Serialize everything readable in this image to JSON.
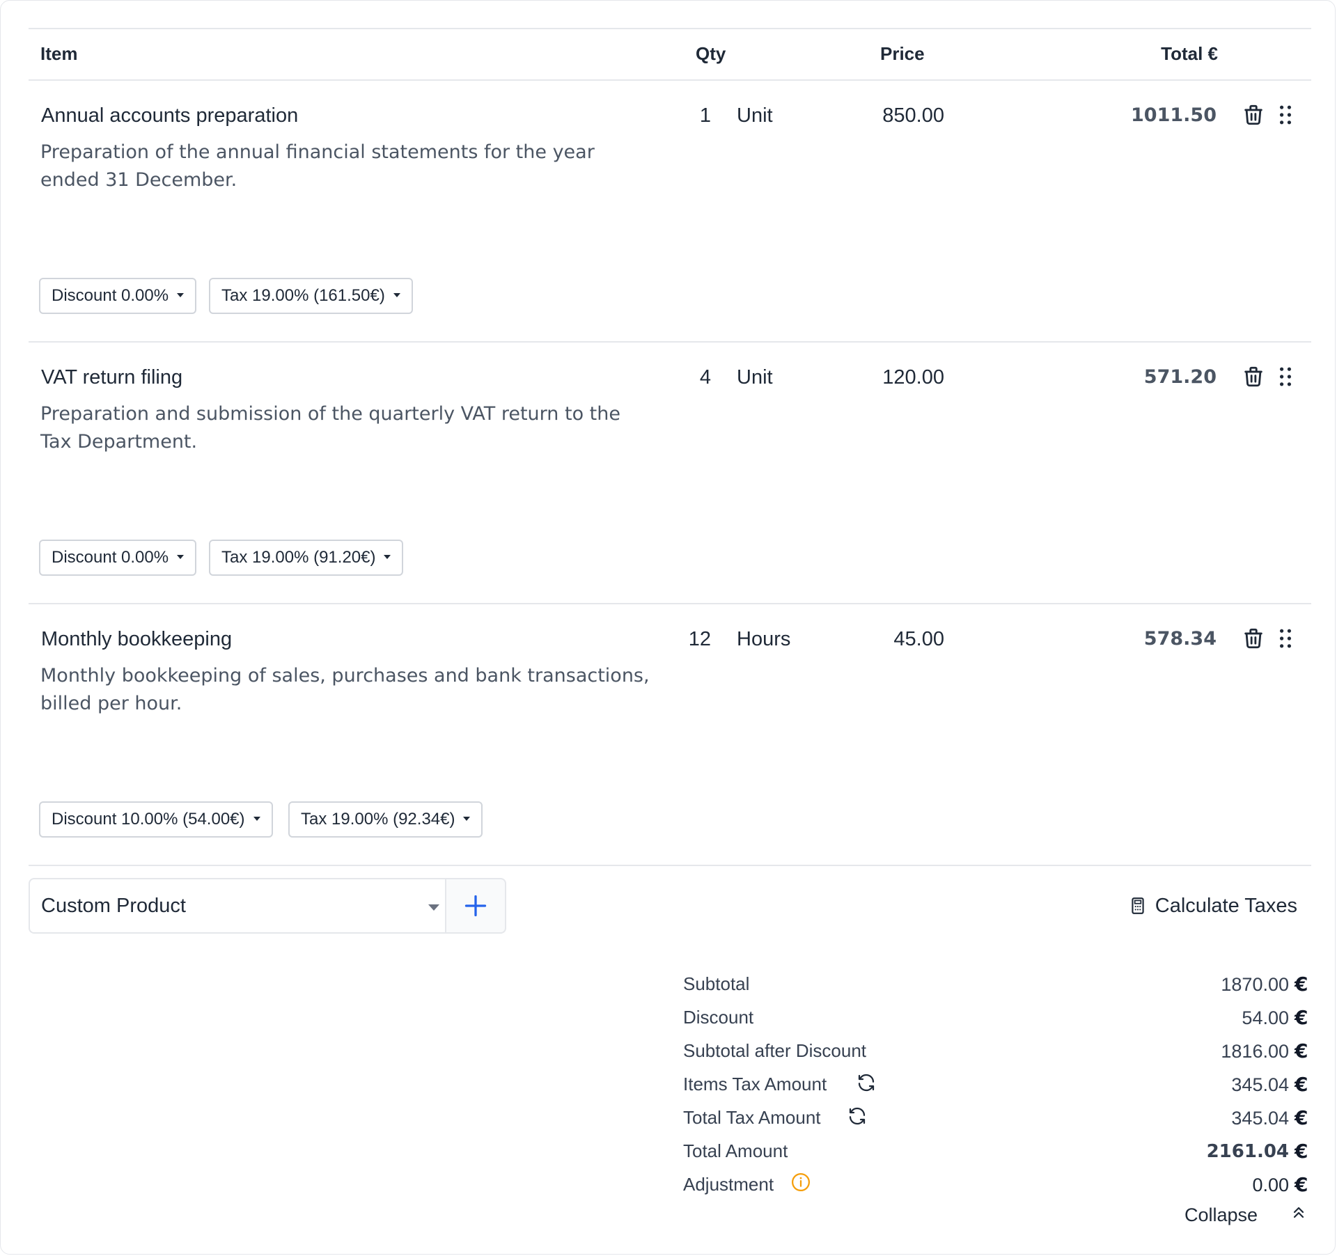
{
  "table_header": {
    "item": "Item",
    "qty": "Qty",
    "price": "Price",
    "total": "Total €"
  },
  "items": [
    {
      "name": "Annual accounts preparation",
      "description": "Preparation of the annual financial statements for the year ended 31 December.",
      "qty": "1",
      "unit": "Unit",
      "price": "850.00",
      "total": "1011.50",
      "discount_label": "Discount 0.00%",
      "tax_label": "Tax 19.00% (161.50€)"
    },
    {
      "name": "VAT return filing",
      "description": "Preparation and submission of the quarterly VAT return to the Tax Department.",
      "qty": "4",
      "unit": "Unit",
      "price": "120.00",
      "total": "571.20",
      "discount_label": "Discount 0.00%",
      "tax_label": "Tax 19.00% (91.20€)"
    },
    {
      "name": "Monthly bookkeeping",
      "description": "Monthly bookkeeping of sales, purchases and bank transactions, billed per hour.",
      "qty": "12",
      "unit": "Hours",
      "price": "45.00",
      "total": "578.34",
      "discount_label": "Discount 10.00% (54.00€)",
      "tax_label": "Tax 19.00% (92.34€)"
    }
  ],
  "add_product": {
    "selected": "Custom Product"
  },
  "calculate_taxes_label": "Calculate Taxes",
  "summary": {
    "subtotal_label": "Subtotal",
    "subtotal_value": "1870.00",
    "discount_label": "Discount",
    "discount_value": "54.00",
    "subtotal_after_discount_label": "Subtotal after Discount",
    "subtotal_after_discount_value": "1816.00",
    "items_tax_label": "Items Tax Amount",
    "items_tax_value": "345.04",
    "total_tax_label": "Total Tax Amount",
    "total_tax_value": "345.04",
    "total_amount_label": "Total Amount",
    "total_amount_value": "2161.04",
    "adjustment_label": "Adjustment",
    "adjustment_value": "0.00",
    "currency_symbol": "€"
  },
  "collapse_label": "Collapse",
  "colors": {
    "accent": "#2563eb",
    "info": "#f59e0b"
  },
  "icons": [
    "trash-icon",
    "drag-handle-icon",
    "plus-icon",
    "calculator-icon",
    "refresh-icon",
    "info-icon",
    "chevron-double-up-icon"
  ]
}
